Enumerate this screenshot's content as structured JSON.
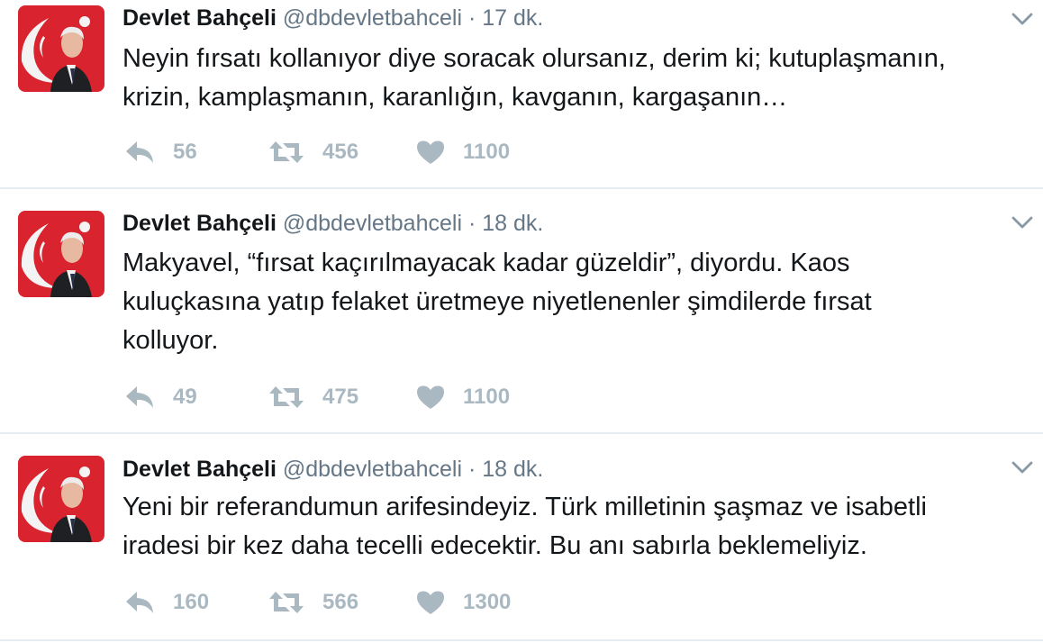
{
  "colors": {
    "name": "#14171a",
    "muted": "#657786",
    "action": "#aab8c2",
    "divider": "#e6ecf0",
    "flag_red": "#d9232e"
  },
  "icons": {
    "reply": "reply-arrow-icon",
    "retweet": "retweet-arrows-icon",
    "like": "heart-icon",
    "menu": "chevron-down-icon"
  },
  "tweets": [
    {
      "name": "Devlet Bahçeli",
      "handle": "@dbdevletbahceli",
      "separator": "·",
      "time": "17 dk.",
      "lines": [
        "Neyin fırsatı kollanıyor diye soracak olursanız, derim ki; kutuplaşmanın,",
        "krizin, kamplaşmanın, karanlığın, kavganın, kargaşanın…"
      ],
      "replies": "56",
      "retweets": "456",
      "likes": "1100"
    },
    {
      "name": "Devlet Bahçeli",
      "handle": "@dbdevletbahceli",
      "separator": "·",
      "time": "18 dk.",
      "lines": [
        "Makyavel, “fırsat kaçırılmayacak kadar güzeldir”, diyordu. Kaos",
        "kuluçkasına yatıp felaket üretmeye niyetlenenler şimdilerde fırsat",
        "kolluyor."
      ],
      "replies": "49",
      "retweets": "475",
      "likes": "1100"
    },
    {
      "name": "Devlet Bahçeli",
      "handle": "@dbdevletbahceli",
      "separator": "·",
      "time": "18 dk.",
      "lines": [
        "Yeni bir referandumun arifesindeyiz. Türk milletinin şaşmaz ve isabetli",
        "iradesi bir kez daha tecelli edecektir. Bu anı sabırla beklemeliyiz."
      ],
      "replies": "160",
      "retweets": "566",
      "likes": "1300"
    }
  ]
}
